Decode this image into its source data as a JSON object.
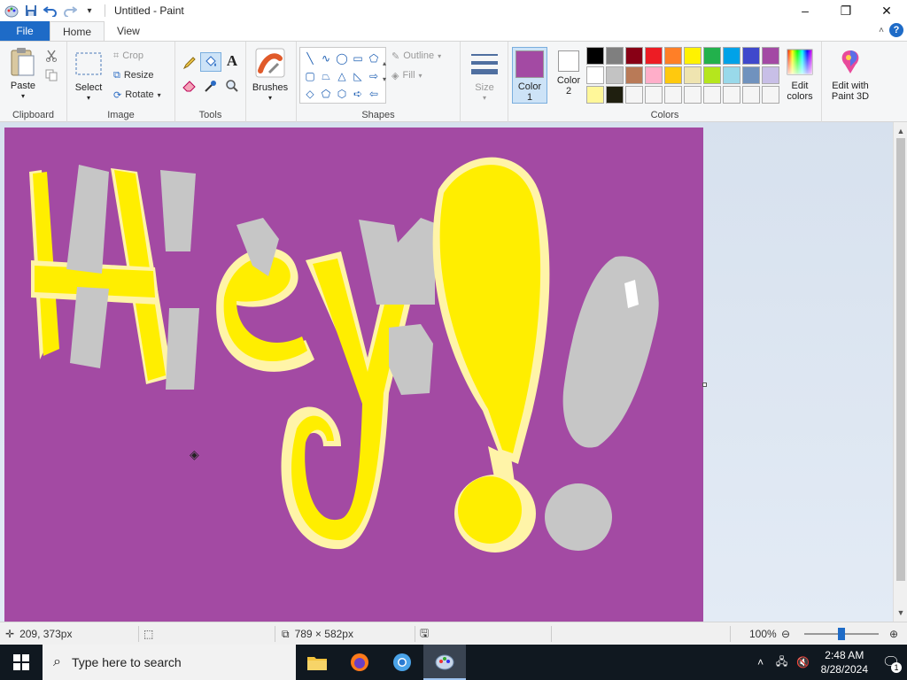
{
  "window": {
    "title": "Untitled - Paint",
    "minimize_icon": "–",
    "maximize_icon": "❐",
    "close_icon": "✕"
  },
  "ribbon_tabs": [
    {
      "label": "File"
    },
    {
      "label": "Home"
    },
    {
      "label": "View"
    }
  ],
  "ribbon": {
    "clipboard": {
      "group_label": "Clipboard",
      "paste_label": "Paste"
    },
    "image": {
      "group_label": "Image",
      "select_label": "Select",
      "crop_label": "Crop",
      "resize_label": "Resize",
      "rotate_label": "Rotate"
    },
    "tools": {
      "group_label": "Tools"
    },
    "brushes": {
      "label": "Brushes"
    },
    "shapes": {
      "group_label": "Shapes",
      "outline_label": "Outline",
      "fill_label": "Fill"
    },
    "size": {
      "label": "Size"
    },
    "colors": {
      "group_label": "Colors",
      "color1_label": "Color",
      "color1_sub": "1",
      "color2_label": "Color",
      "color2_sub": "2",
      "color1": "#a34aa3",
      "color2": "#ffffff",
      "edit_colors_label": "Edit colors",
      "palette": [
        "#000000",
        "#7f7f7f",
        "#880015",
        "#ed1c24",
        "#ff7f27",
        "#fff200",
        "#22b14c",
        "#00a2e8",
        "#3f48cc",
        "#a349a4",
        "#ffffff",
        "#c3c3c3",
        "#b97a57",
        "#ffaec9",
        "#ffc90e",
        "#efe4b0",
        "#b5e61d",
        "#99d9ea",
        "#7092be",
        "#c8bfe7",
        "#fff799",
        "#1f1f0f",
        "#f5f5f5",
        "#f5f5f5",
        "#f5f5f5",
        "#f5f5f5",
        "#f5f5f5",
        "#f5f5f5",
        "#f5f5f5",
        "#f5f5f5"
      ]
    },
    "paint3d": {
      "label": "Edit with Paint 3D"
    }
  },
  "canvas": {
    "background": "#a34aa3",
    "drawing": "Hey!!"
  },
  "status": {
    "cursor_pos": "209, 373px",
    "canvas_size": "789 × 582px",
    "zoom": "100%"
  },
  "taskbar": {
    "search_placeholder": "Type here to search",
    "time": "2:48 AM",
    "date": "8/28/2024",
    "notification_count": "1"
  }
}
